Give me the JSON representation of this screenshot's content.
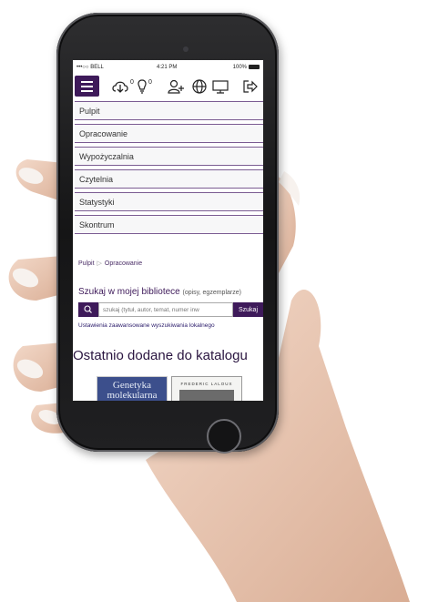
{
  "statusbar": {
    "carrier": "•••○○ BELL",
    "time": "4:21 PM",
    "battery": "100%"
  },
  "toolbar": {
    "downloads_count": "0",
    "notifications_count": "0"
  },
  "menu": {
    "items": [
      {
        "label": "Pulpit"
      },
      {
        "label": "Opracowanie"
      },
      {
        "label": "Wypożyczalnia"
      },
      {
        "label": "Czytelnia"
      },
      {
        "label": "Statystyki"
      },
      {
        "label": "Skontrum"
      }
    ]
  },
  "breadcrumb": {
    "home": "Pulpit",
    "current": "Opracowanie"
  },
  "search": {
    "title": "Szukaj w mojej bibliotece",
    "subtitle": "(opisy, egzemplarze)",
    "placeholder": "szukaj (tytuł, autor, temat, numer inw",
    "button_label": "Szukaj",
    "advanced_link": "Ustawienia zaawansowane wyszukiwania lokalnego"
  },
  "recent": {
    "title": "Ostatnio dodane do katalogu",
    "books": [
      {
        "cover_text": "Genetyka molekularna"
      },
      {
        "cover_text": "FREDERIC LALOUX"
      }
    ]
  },
  "icons": [
    "menu-icon",
    "download-icon",
    "bulb-icon",
    "add-user-icon",
    "globe-icon",
    "monitor-icon",
    "logout-icon",
    "search-icon"
  ],
  "colors": {
    "accent": "#3e1a5a",
    "menu_border": "#7b5c92",
    "link": "#2a1b6a"
  }
}
